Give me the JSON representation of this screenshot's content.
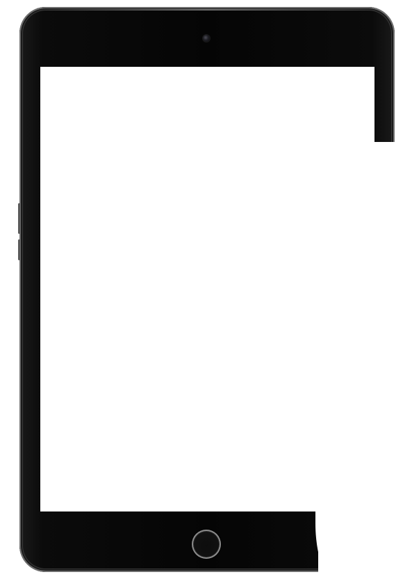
{
  "device": {
    "type": "tablet",
    "frame_color": "#050505",
    "screen_color": "#ffffff",
    "trim_color": "#6f6f6f"
  },
  "icons": {
    "camera": "camera-icon",
    "home": "home-button-icon"
  }
}
